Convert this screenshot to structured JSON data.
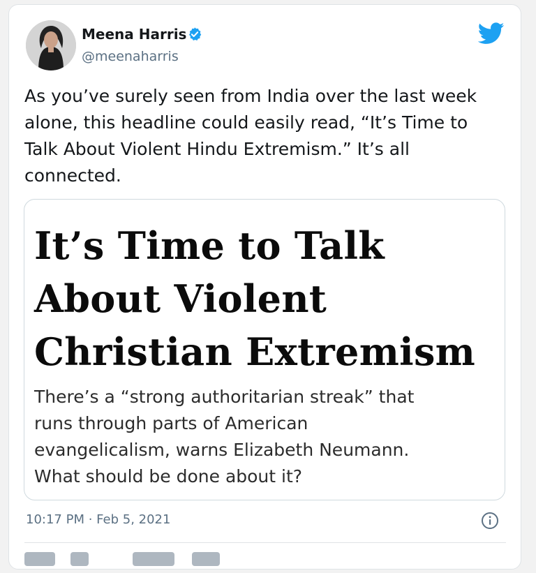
{
  "tweet": {
    "author": {
      "name": "Meena Harris",
      "handle": "@meenaharris",
      "verified": true
    },
    "text_lines": [
      "As you’ve surely seen from India over the last week",
      "alone, this headline could easily read, “It’s Time to",
      "Talk About Violent Hindu Extremism.” It’s all",
      "connected."
    ],
    "embed": {
      "headline_lines": [
        "It’s Time to Talk",
        "About Violent",
        "Christian Extremism"
      ],
      "description_lines": [
        "There’s a “strong authoritarian streak” that",
        "runs through parts of American",
        "evangelicalism, warns Elizabeth Neumann.",
        "What should be done about it?"
      ]
    },
    "timestamp": "10:17 PM · Feb 5, 2021"
  },
  "icons": {
    "verified": "verified-badge-icon",
    "brand": "twitter-bird-icon",
    "info": "info-icon"
  },
  "colors": {
    "brand_blue": "#1da1f2",
    "text_primary": "#14171a",
    "text_secondary": "#5b7083",
    "border": "#cfd9de"
  }
}
